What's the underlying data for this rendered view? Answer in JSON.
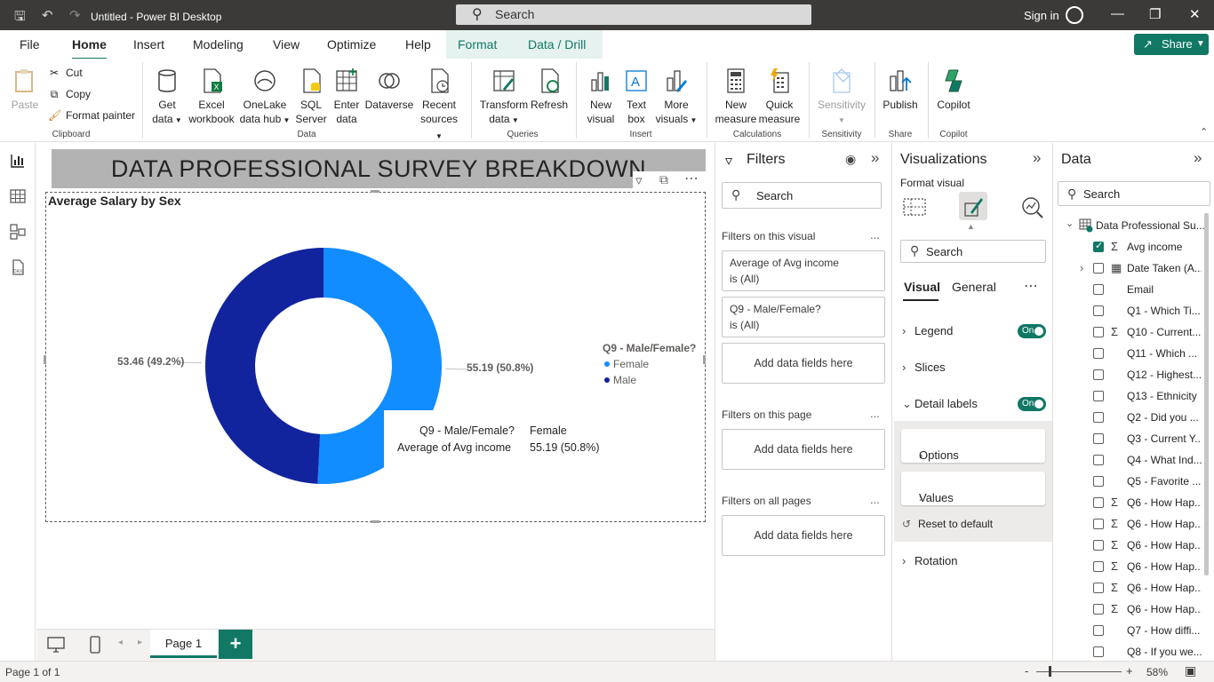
{
  "titlebar": {
    "title": "Untitled - Power BI Desktop",
    "search_placeholder": "Search",
    "signin": "Sign in"
  },
  "tabs": [
    "File",
    "Home",
    "Insert",
    "Modeling",
    "View",
    "Optimize",
    "Help",
    "Format",
    "Data / Drill"
  ],
  "share_label": "Share",
  "ribbon": {
    "clipboard": {
      "paste": "Paste",
      "cut": "Cut",
      "copy": "Copy",
      "format_painter": "Format painter",
      "label": "Clipboard"
    },
    "data": {
      "get_data": [
        "Get",
        "data"
      ],
      "excel": [
        "Excel",
        "workbook"
      ],
      "onelake": [
        "OneLake",
        "data hub"
      ],
      "sql": [
        "SQL",
        "Server"
      ],
      "enter": [
        "Enter",
        "data"
      ],
      "dataverse": [
        "Dataverse",
        ""
      ],
      "recent": [
        "Recent",
        "sources"
      ],
      "label": "Data"
    },
    "queries": {
      "transform": [
        "Transform",
        "data"
      ],
      "refresh": [
        "Refresh",
        ""
      ],
      "label": "Queries"
    },
    "insert": {
      "new_visual": [
        "New",
        "visual"
      ],
      "text_box": [
        "Text",
        "box"
      ],
      "more": [
        "More",
        "visuals"
      ],
      "label": "Insert"
    },
    "calculations": {
      "new_measure": [
        "New",
        "measure"
      ],
      "quick_measure": [
        "Quick",
        "measure"
      ],
      "label": "Calculations"
    },
    "sensitivity": {
      "btn": [
        "Sensitivity",
        ""
      ],
      "label": "Sensitivity"
    },
    "share": {
      "publish": "Publish",
      "label": "Share"
    },
    "copilot": {
      "btn": "Copilot",
      "label": "Copilot"
    }
  },
  "report": {
    "banner": "DATA PROFESSIONAL SURVEY BREAKDOWN",
    "visual_title": "Average Salary by Sex",
    "tooltip": {
      "k1": "Q9 - Male/Female?",
      "v1": "Female",
      "k2": "Average of Avg income",
      "v2": "55.19 (50.8%)"
    }
  },
  "chart_data": {
    "type": "pie",
    "subtype": "donut",
    "title": "Average Salary by Sex",
    "legend_title": "Q9 - Male/Female?",
    "legend_position": "right",
    "categories": [
      "Female",
      "Male"
    ],
    "values": [
      55.19,
      53.46
    ],
    "percent": [
      50.8,
      49.2
    ],
    "data_labels": [
      "55.19 (50.8%)",
      "53.46 (49.2%)"
    ],
    "colors": [
      "#118dff",
      "#12239e"
    ],
    "highlighted": "Female"
  },
  "pages": {
    "current": "Page 1",
    "status": "Page 1 of 1"
  },
  "zoom": "58%",
  "filters": {
    "title": "Filters",
    "search": "Search",
    "on_visual": "Filters on this visual",
    "cards": [
      {
        "field": "Average of Avg income",
        "state": "is (All)"
      },
      {
        "field": "Q9 - Male/Female?",
        "state": "is (All)"
      }
    ],
    "add": "Add data fields here",
    "on_page": "Filters on this page",
    "on_all": "Filters on all pages",
    "dots": "..."
  },
  "visualizations": {
    "title": "Visualizations",
    "subtitle": "Format visual",
    "search": "Search",
    "tab_visual": "Visual",
    "tab_general": "General",
    "sections": {
      "legend": "Legend",
      "slices": "Slices",
      "detail_labels": "Detail labels",
      "options": "Options",
      "values": "Values",
      "reset": "Reset to default",
      "rotation": "Rotation"
    },
    "toggle_on": "On"
  },
  "datapane": {
    "title": "Data",
    "search": "Search",
    "table": "Data Professional Su...",
    "fields": [
      {
        "name": "Avg income",
        "sigma": true,
        "checked": true
      },
      {
        "name": "Date Taken (A...",
        "sigma": false,
        "checked": false,
        "calendar": true
      },
      {
        "name": "Email",
        "sigma": false,
        "checked": false
      },
      {
        "name": "Q1 - Which Ti...",
        "sigma": false,
        "checked": false
      },
      {
        "name": "Q10 - Current...",
        "sigma": true,
        "checked": false
      },
      {
        "name": "Q11 - Which ...",
        "sigma": false,
        "checked": false
      },
      {
        "name": "Q12 - Highest...",
        "sigma": false,
        "checked": false
      },
      {
        "name": "Q13 - Ethnicity",
        "sigma": false,
        "checked": false
      },
      {
        "name": "Q2 - Did you ...",
        "sigma": false,
        "checked": false
      },
      {
        "name": "Q3 - Current Y...",
        "sigma": false,
        "checked": false
      },
      {
        "name": "Q4 - What Ind...",
        "sigma": false,
        "checked": false
      },
      {
        "name": "Q5 - Favorite ...",
        "sigma": false,
        "checked": false
      },
      {
        "name": "Q6 - How Hap...",
        "sigma": true,
        "checked": false
      },
      {
        "name": "Q6 - How Hap...",
        "sigma": true,
        "checked": false
      },
      {
        "name": "Q6 - How Hap...",
        "sigma": true,
        "checked": false
      },
      {
        "name": "Q6 - How Hap...",
        "sigma": true,
        "checked": false
      },
      {
        "name": "Q6 - How Hap...",
        "sigma": true,
        "checked": false
      },
      {
        "name": "Q6 - How Hap...",
        "sigma": true,
        "checked": false
      },
      {
        "name": "Q7 - How diffi...",
        "sigma": false,
        "checked": false
      },
      {
        "name": "Q8 - If you we...",
        "sigma": false,
        "checked": false
      }
    ]
  }
}
